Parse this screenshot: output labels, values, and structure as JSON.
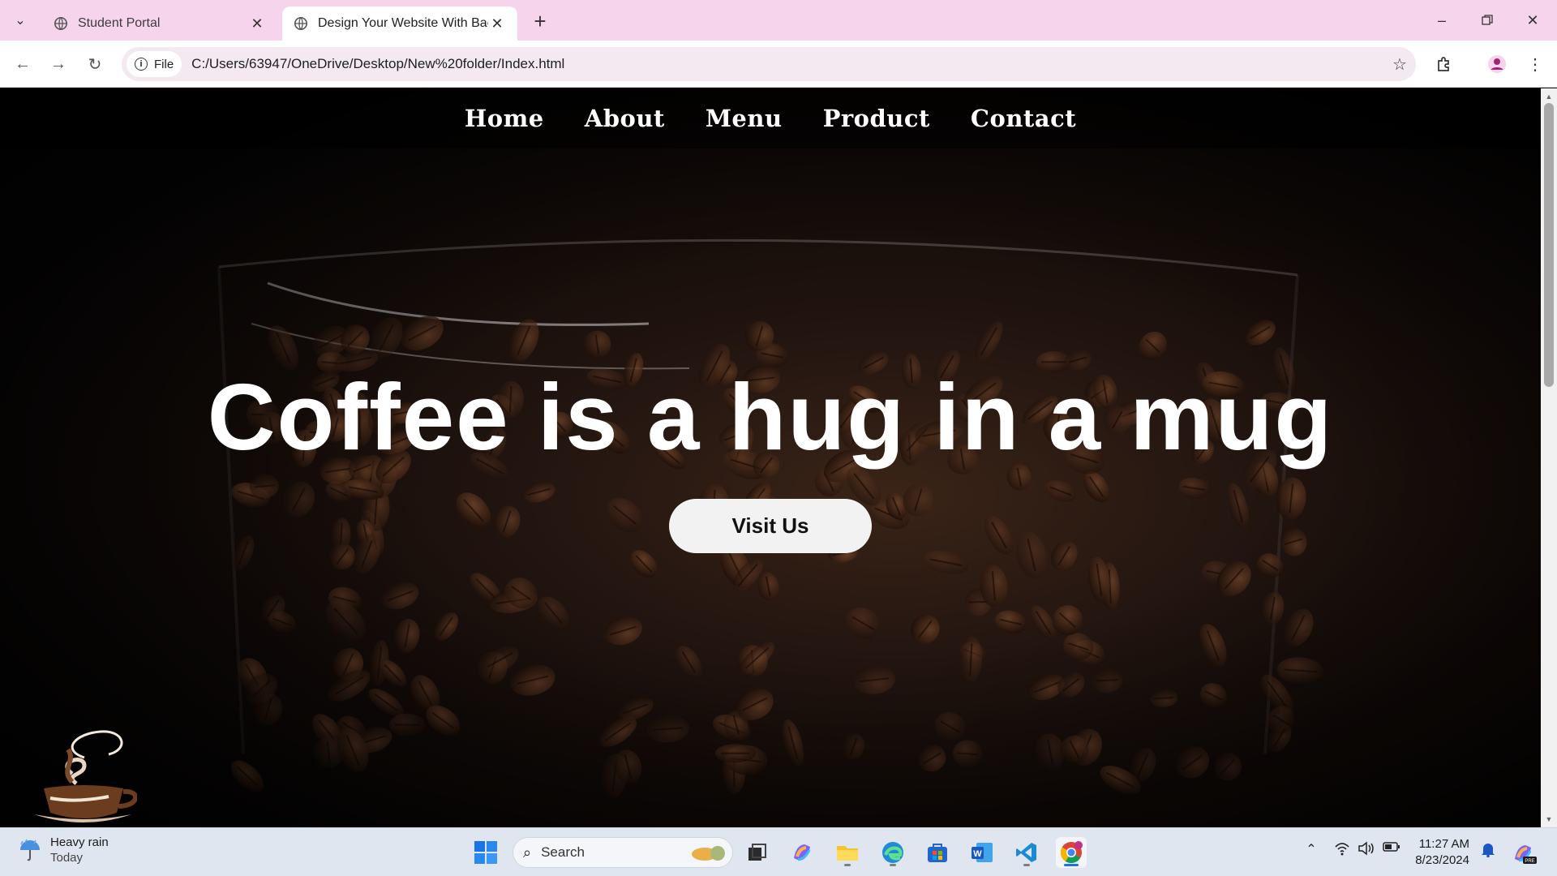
{
  "browser": {
    "tabs": [
      {
        "title": "Student Portal",
        "active": false
      },
      {
        "title": "Design Your Website With Back",
        "active": true
      }
    ],
    "address": {
      "scheme_chip": "File",
      "url": "C:/Users/63947/OneDrive/Desktop/New%20folder/Index.html"
    }
  },
  "page": {
    "nav": [
      "Home",
      "About",
      "Menu",
      "Product",
      "Contact"
    ],
    "hero_title": "Coffee is a hug in a mug",
    "cta_label": "Visit Us"
  },
  "taskbar": {
    "weather": {
      "condition": "Heavy rain",
      "day": "Today"
    },
    "search_placeholder": "Search",
    "time": "11:27 AM",
    "date": "8/23/2024"
  },
  "colors": {
    "tabstrip": "#f6d5ec",
    "omnibox": "#f4e9f1",
    "page_background": "#140c09",
    "hero_text": "#ffffff",
    "button": "#f2f2f2",
    "taskbar": "#dfe6ef"
  }
}
